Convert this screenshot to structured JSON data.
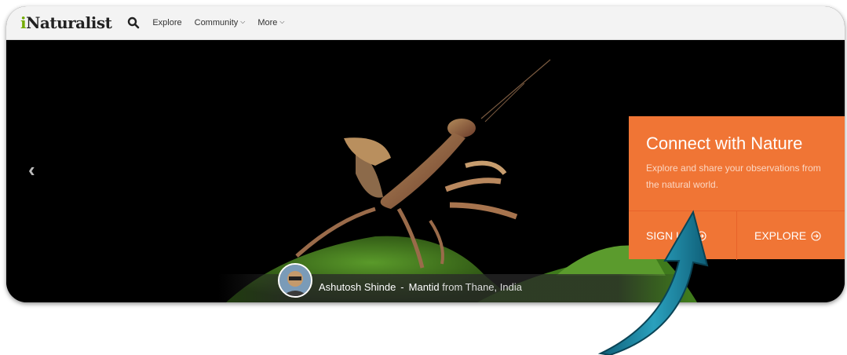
{
  "navbar": {
    "logo_first": "i",
    "logo_rest": "Naturalist",
    "links": [
      {
        "label": "Explore",
        "dropdown": false
      },
      {
        "label": "Community",
        "dropdown": true
      },
      {
        "label": "More",
        "dropdown": true
      }
    ]
  },
  "hero": {
    "prev_arrow": "‹",
    "caption": {
      "author": "Ashutosh Shinde",
      "separator": "-",
      "taxon": "Mantid",
      "from_text": "from Thane, India"
    }
  },
  "cta": {
    "title": "Connect with Nature",
    "description": "Explore and share your observations from the natural world.",
    "signup_label": "SIGN UP",
    "explore_label": "EXPLORE"
  },
  "colors": {
    "brand_green": "#74ac00",
    "cta_orange": "#f07535",
    "annotation_arrow": "#1f8fa8"
  }
}
